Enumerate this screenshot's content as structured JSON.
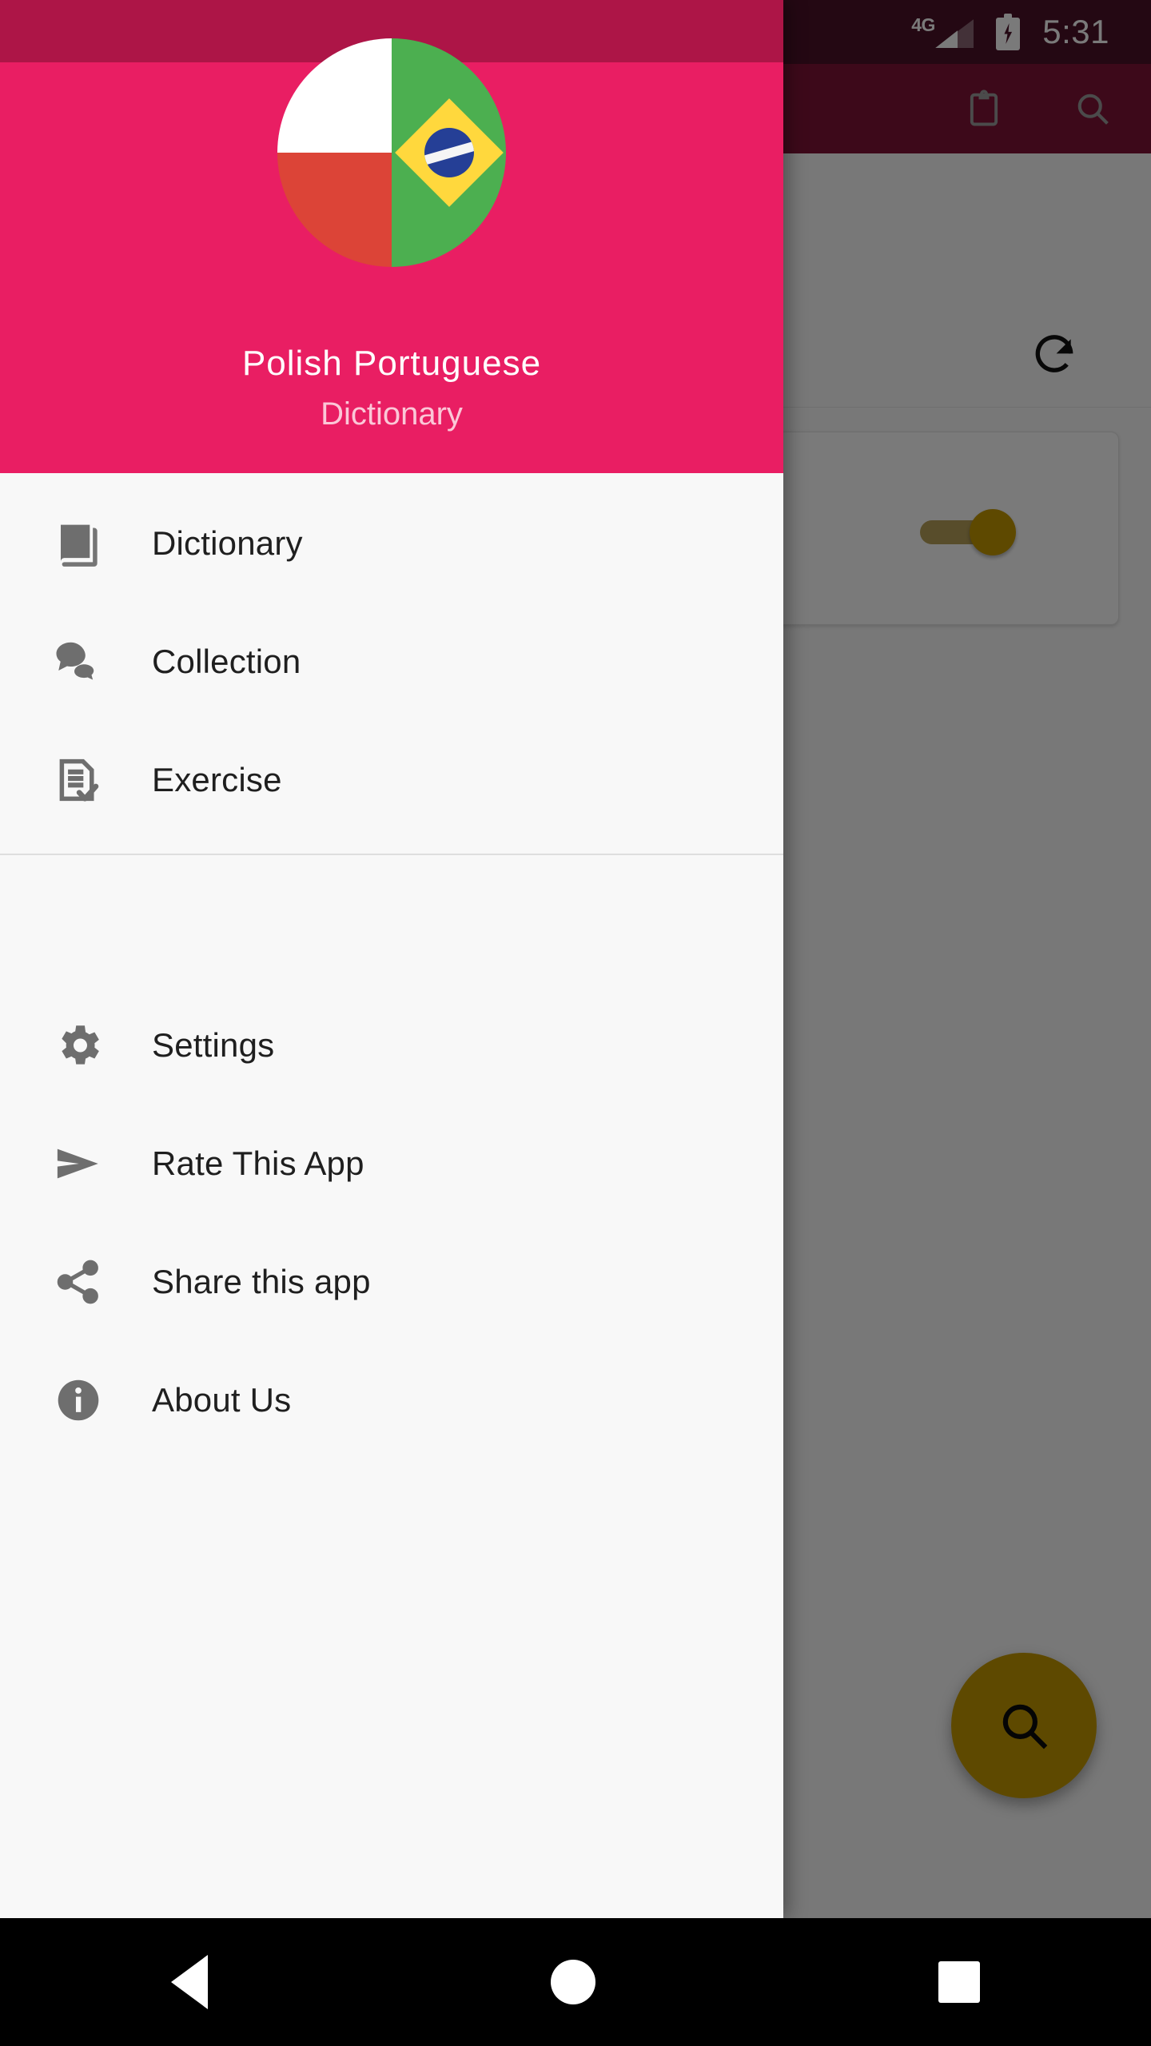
{
  "status_bar": {
    "network_label": "4G",
    "signal_icon": "signal-bars-icon",
    "battery_icon": "battery-charging-icon",
    "time": "5:31"
  },
  "app_bar": {
    "clipboard_icon": "clipboard-icon",
    "search_icon": "search-icon"
  },
  "background": {
    "refresh_icon": "refresh-icon",
    "toggle": {
      "name": "setting-toggle",
      "state": "on"
    },
    "fab": {
      "icon": "search-icon",
      "label": "Search"
    }
  },
  "drawer": {
    "header": {
      "avatar_icon": "polish-portuguese-flags-avatar",
      "title": "Polish Portuguese",
      "subtitle": "Dictionary"
    },
    "primary_items": [
      {
        "id": "dictionary",
        "label": "Dictionary",
        "icon": "book-icon"
      },
      {
        "id": "collection",
        "label": "Collection",
        "icon": "chat-bubbles-icon"
      },
      {
        "id": "exercise",
        "label": "Exercise",
        "icon": "document-check-icon"
      }
    ],
    "secondary_items": [
      {
        "id": "settings",
        "label": "Settings",
        "icon": "gear-icon"
      },
      {
        "id": "rate",
        "label": "Rate This App",
        "icon": "send-arrow-icon"
      },
      {
        "id": "share",
        "label": "Share this app",
        "icon": "share-nodes-icon"
      },
      {
        "id": "about",
        "label": "About Us",
        "icon": "info-circle-icon"
      }
    ]
  },
  "nav_bar": {
    "back": "back-button",
    "home": "home-button",
    "recents": "recents-button"
  },
  "colors": {
    "status_bar": "#4d1129",
    "drawer_status_bar": "#ad1547",
    "app_bar": "#801338",
    "header_pink": "#e91e63",
    "accent_gold": "#c59a00",
    "drawer_bg": "#f8f8f8"
  }
}
